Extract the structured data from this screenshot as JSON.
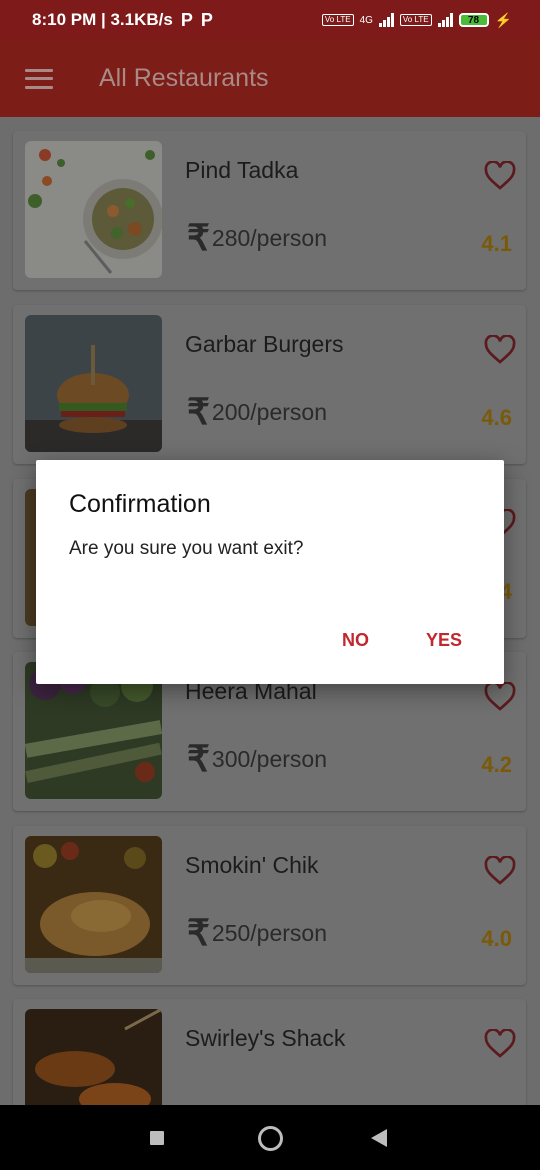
{
  "status_bar": {
    "time_speed": "8:10 PM | 3.1KB/s",
    "p_icon_1": "P",
    "p_icon_2": "P",
    "volte_1": "Vo LTE",
    "network_type": "4G",
    "volte_2": "Vo LTE",
    "battery": "78",
    "charging_icon": "bolt-icon"
  },
  "toolbar": {
    "title": "All Restaurants",
    "menu_icon": "hamburger-menu-icon"
  },
  "restaurants": [
    {
      "name": "Pind Tadka",
      "price": "280/person",
      "rating": "4.1"
    },
    {
      "name": "Garbar Burgers",
      "price": "200/person",
      "rating": "4.6"
    },
    {
      "name": "",
      "price": "",
      "rating": "4"
    },
    {
      "name": "Heera Mahal",
      "price": "300/person",
      "rating": "4.2"
    },
    {
      "name": "Smokin' Chik",
      "price": "250/person",
      "rating": "4.0"
    },
    {
      "name": "Swirley's Shack",
      "price": "",
      "rating": ""
    }
  ],
  "currency_symbol": "₹",
  "dialog": {
    "title": "Confirmation",
    "message": "Are you sure you want exit?",
    "no_label": "NO",
    "yes_label": "YES"
  },
  "colors": {
    "primary": "#c0392b",
    "accent": "#c0282d",
    "rating": "#f0b41e"
  }
}
